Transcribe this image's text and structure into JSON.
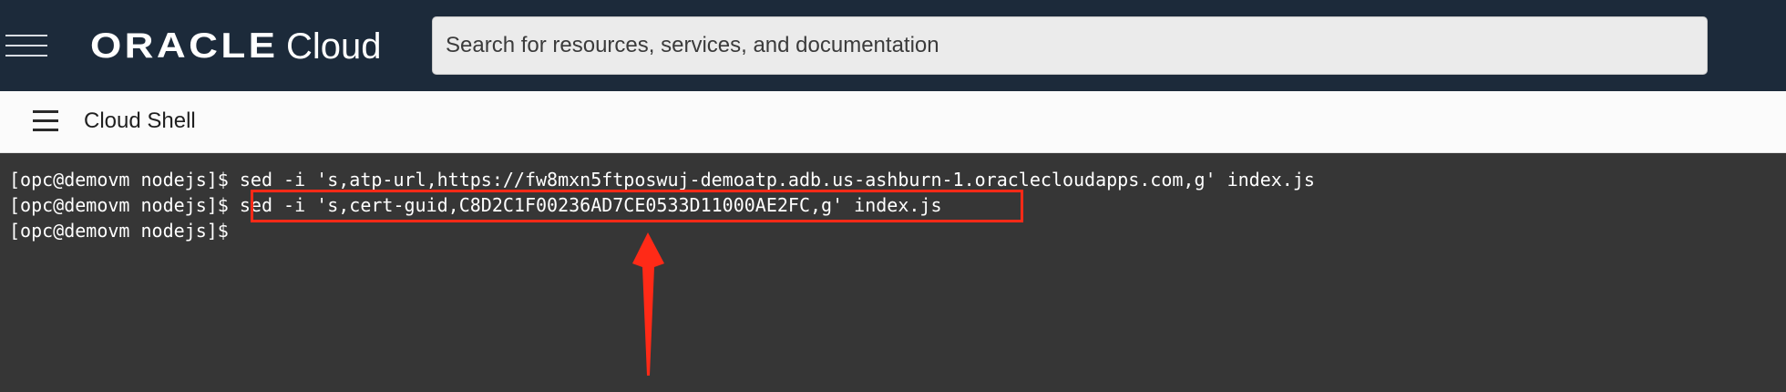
{
  "header": {
    "menu_icon": "hamburger-menu-icon",
    "logo_brand": "ORACLE",
    "logo_product": "Cloud",
    "search_placeholder": "Search for resources, services, and documentation"
  },
  "cloud_shell": {
    "menu_icon": "hamburger-menu-icon",
    "title": "Cloud Shell"
  },
  "terminal": {
    "lines": [
      {
        "prompt": "[opc@demovm nodejs]$ ",
        "command": "sed -i 's,atp-url,https://fw8mxn5ftposwuj-demoatp.adb.us-ashburn-1.oraclecloudapps.com,g' index.js"
      },
      {
        "prompt": "[opc@demovm nodejs]$ ",
        "command": "sed -i 's,cert-guid,C8D2C1F00236AD7CE0533D11000AE2FC,g' index.js"
      },
      {
        "prompt": "[opc@demovm nodejs]$",
        "command": ""
      }
    ]
  },
  "annotation": {
    "highlight_color": "#ff2a17",
    "arrow_color": "#ff2a17"
  },
  "colors": {
    "header_bg": "#1c2a3a",
    "terminal_bg": "#363636"
  }
}
